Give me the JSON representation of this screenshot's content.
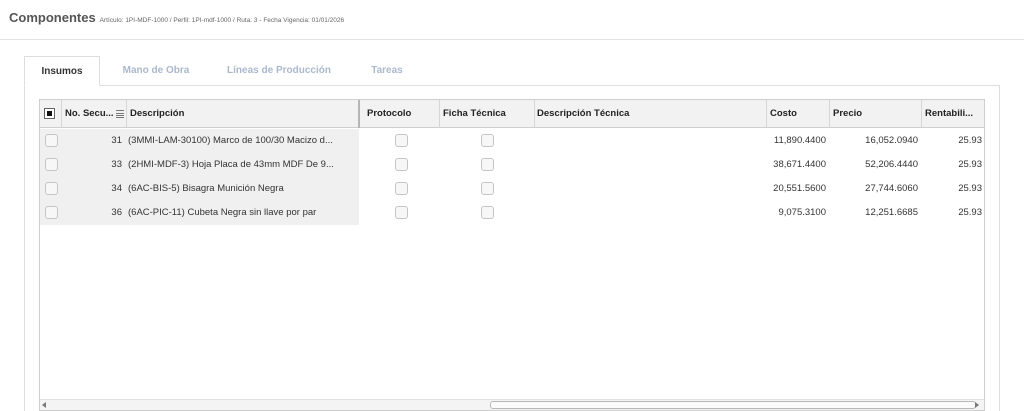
{
  "header": {
    "title": "Componentes",
    "subtitle": "Artículo: 1PI-MDF-1000 / Perfil: 1PI-mdf-1000 / Ruta: 3 - Fecha Vigencia: 01/01/2026"
  },
  "tabs": [
    {
      "label": "Insumos",
      "active": true
    },
    {
      "label": "Mano de Obra",
      "active": false
    },
    {
      "label": "Líneas de Producción",
      "active": false
    },
    {
      "label": "Tareas",
      "active": false
    }
  ],
  "grid": {
    "columns": {
      "seq": "No. Secu...",
      "desc": "Descripción",
      "protocolo": "Protocolo",
      "ficha": "Ficha Técnica",
      "desc_tec": "Descripción Técnica",
      "costo": "Costo",
      "precio": "Precio",
      "rentab": "Rentabili..."
    },
    "rows": [
      {
        "seq": "31",
        "desc": "(3MMI-LAM-30100) Marco de 100/30 Macizo d...",
        "desc_tec": "",
        "costo": "11,890.4400",
        "precio": "16,052.0940",
        "rentab": "25.93"
      },
      {
        "seq": "33",
        "desc": "(2HMI-MDF-3) Hoja Placa de 43mm MDF De 9...",
        "desc_tec": "",
        "costo": "38,671.4400",
        "precio": "52,206.4440",
        "rentab": "25.93"
      },
      {
        "seq": "34",
        "desc": "(6AC-BIS-5) Bisagra Munición Negra",
        "desc_tec": "",
        "costo": "20,551.5600",
        "precio": "27,744.6060",
        "rentab": "25.93"
      },
      {
        "seq": "36",
        "desc": "(6AC-PIC-11) Cubeta Negra sin llave por par",
        "desc_tec": "",
        "costo": "9,075.3100",
        "precio": "12,251.6685",
        "rentab": "25.93"
      }
    ]
  }
}
